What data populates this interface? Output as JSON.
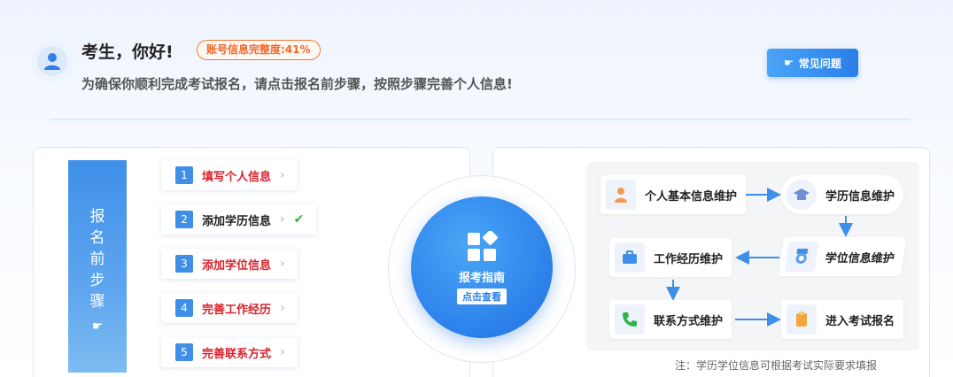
{
  "header": {
    "greeting": "考生，你好!",
    "completeness": "账号信息完整度:41%",
    "subtitle": "为确保你顺利完成考试报名，请点击报名前步骤，按照步骤完善个人信息!",
    "faq_label": "常见问题"
  },
  "side_banner": {
    "chars": [
      "报",
      "名",
      "前",
      "步",
      "骤"
    ]
  },
  "steps": [
    {
      "num": "1",
      "label": "填写个人信息",
      "done": false
    },
    {
      "num": "2",
      "label": "添加学历信息",
      "done": true
    },
    {
      "num": "3",
      "label": "添加学位信息",
      "done": false
    },
    {
      "num": "4",
      "label": "完善工作经历",
      "done": false
    },
    {
      "num": "5",
      "label": "完善联系方式",
      "done": false
    }
  ],
  "guide": {
    "title": "报考指南",
    "button": "点击查看"
  },
  "flow": {
    "nodes": {
      "personal": "个人基本信息维护",
      "education": "学历信息维护",
      "degree": "学位信息维护",
      "work": "工作经历维护",
      "contact": "联系方式维护",
      "enter": "进入考试报名"
    },
    "note": "注：学历学位信息可根据考试实际要求填报"
  },
  "colors": {
    "accent": "#2c80ea",
    "warning": "#f0682a",
    "todo": "#d9232d",
    "done": "#3cb043"
  }
}
